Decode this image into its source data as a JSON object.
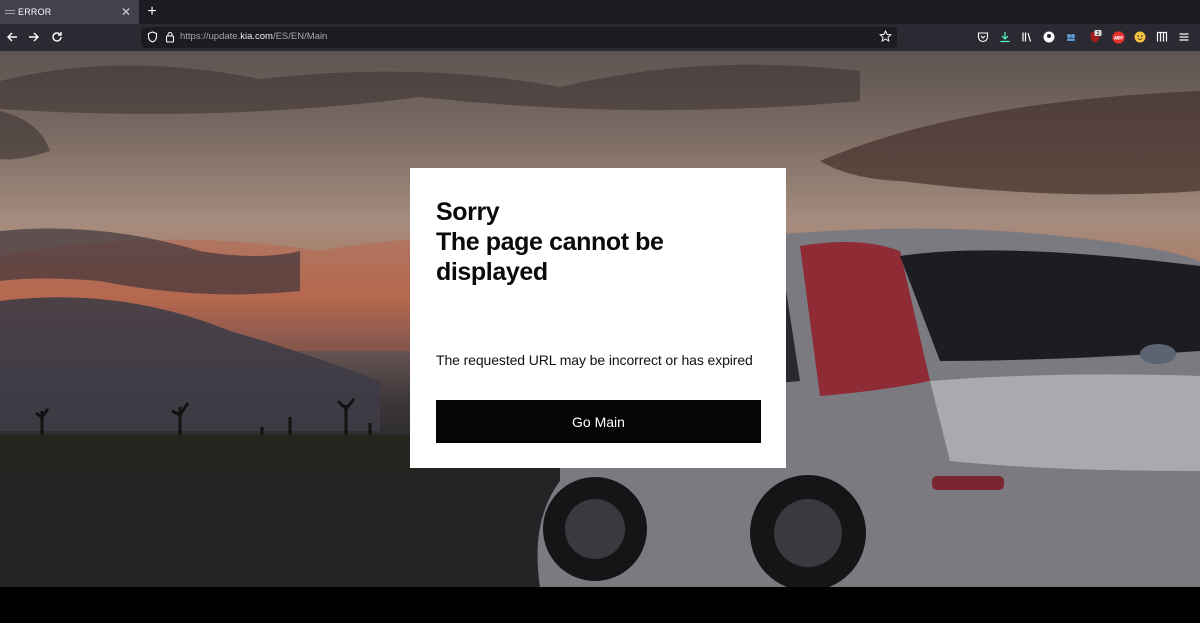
{
  "browser": {
    "tab": {
      "title": "ERROR"
    },
    "new_tab_label": "+",
    "address": {
      "prefix": "https://update.",
      "domain": "kia.com",
      "path": "/ES/EN/Main"
    },
    "badge_count": "2",
    "abp_label": "ABP"
  },
  "dialog": {
    "title_lines": [
      "Sorry",
      "The page cannot be",
      "displayed"
    ],
    "description": "The requested URL may be incorrect or has expired",
    "button_label": "Go Main"
  },
  "colors": {
    "tab_strip": "#1c1b22",
    "toolbar": "#2b2a33",
    "dialog_background": "#ffffff",
    "button_background": "#050505"
  }
}
